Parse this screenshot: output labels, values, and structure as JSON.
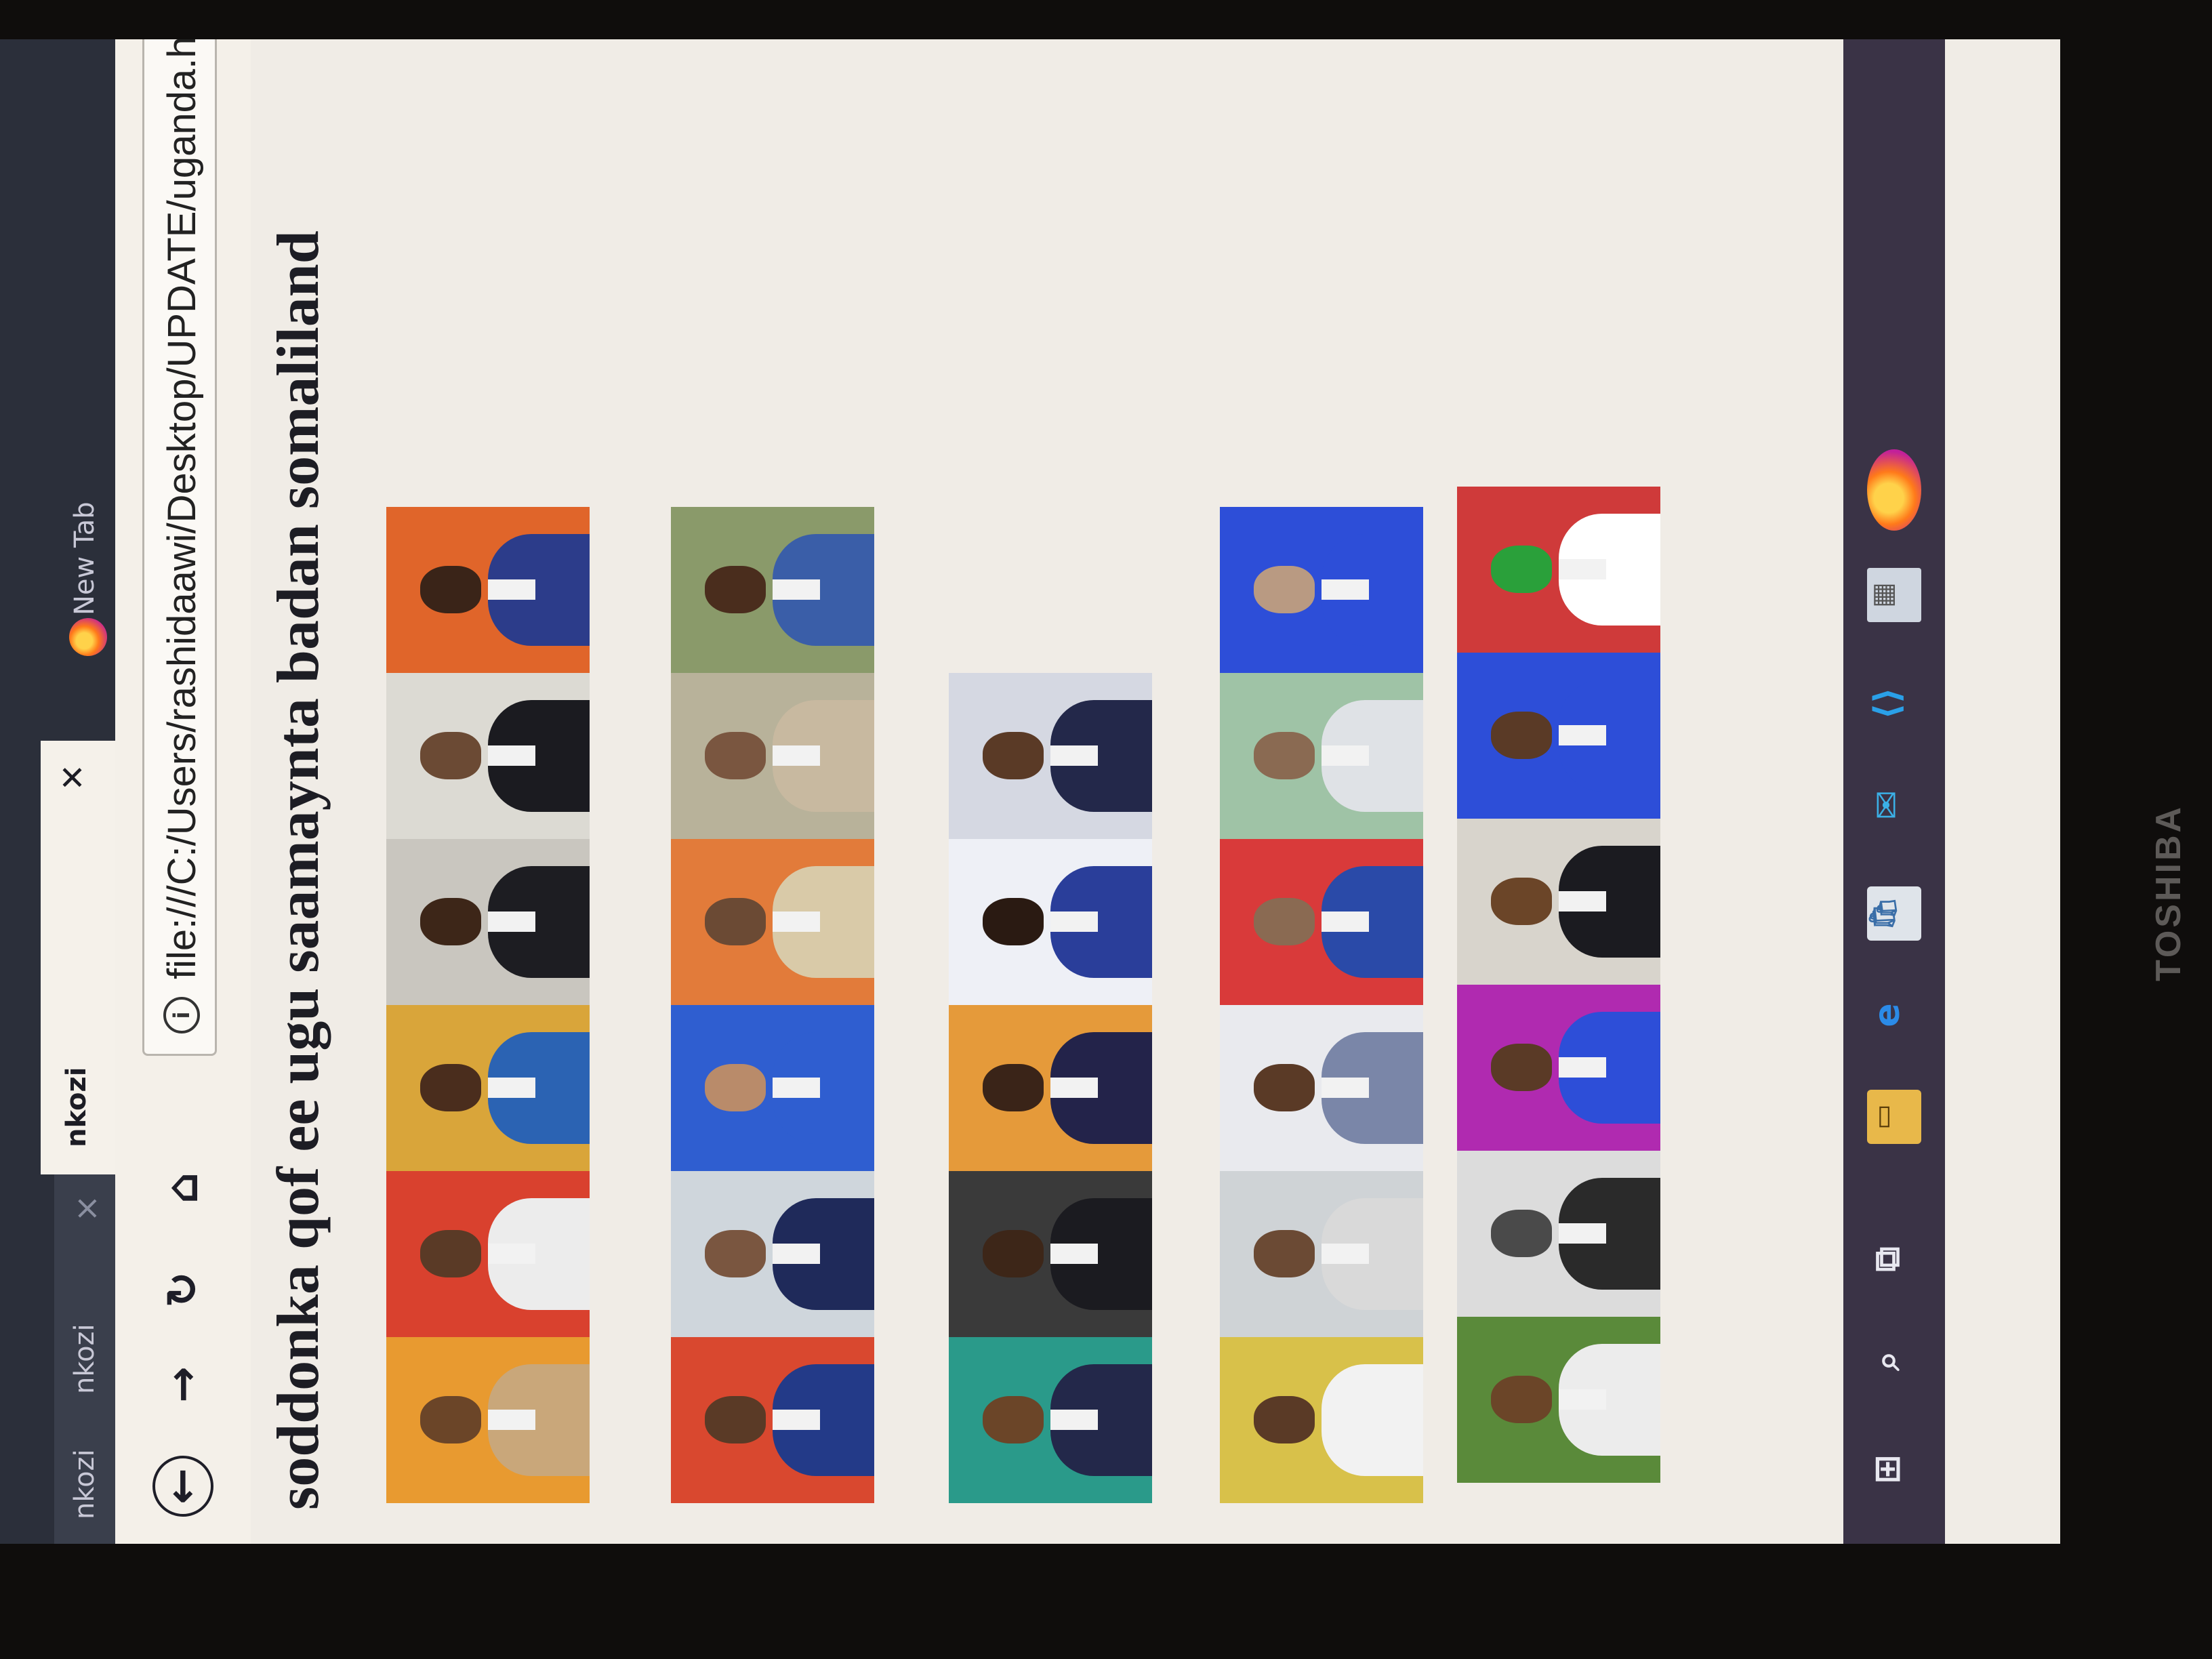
{
  "browser": {
    "tabs": [
      {
        "label": "nkozi",
        "active": false
      },
      {
        "label": "nkozi",
        "active": false
      },
      {
        "label": "nkozi",
        "active": true
      },
      {
        "label": "New Tab",
        "active": false
      }
    ],
    "url": "file:///C:/Users/rashidaawi/Desktop/UPDATE/uganda.html"
  },
  "page": {
    "heading": "soddonka qof ee ugu saamaynta badan somaliland"
  },
  "gallery": {
    "rows": [
      {
        "photos": [
          {
            "bg": "#e89a30",
            "skin": "#6b4528",
            "clothes": "#c9a77a"
          },
          {
            "bg": "#d9412e",
            "skin": "#5a3a26",
            "clothes": "#ececec"
          },
          {
            "bg": "#d9a53a",
            "skin": "#4a2d1d",
            "clothes": "#2b63b3"
          },
          {
            "bg": "#c9c6bf",
            "skin": "#3d2618",
            "clothes": "#1d1d22"
          },
          {
            "bg": "#dcdad3",
            "skin": "#6b4a34",
            "clothes": "#1b1b20"
          },
          {
            "bg": "#e0652a",
            "skin": "#3a2418",
            "clothes": "#2c3c8a"
          }
        ]
      },
      {
        "photos": [
          {
            "bg": "#d9482f",
            "skin": "#5a3a26",
            "clothes": "#233a88"
          },
          {
            "bg": "#cfd6dc",
            "skin": "#7a5640",
            "clothes": "#1f2a5a"
          },
          {
            "bg": "#2f5ed0",
            "skin": "#b98b6a",
            "clothes": "#2f5ed0"
          },
          {
            "bg": "#e27b3a",
            "skin": "#6b4a34",
            "clothes": "#d9caa8"
          },
          {
            "bg": "#b8b29a",
            "skin": "#7a5640",
            "clothes": "#c8b9a0"
          },
          {
            "bg": "#8a9a6a",
            "skin": "#4a2d1d",
            "clothes": "#3a5ea8"
          }
        ]
      },
      {
        "photos": [
          {
            "bg": "#2a9a8a",
            "skin": "#6b4528",
            "clothes": "#23284a"
          },
          {
            "bg": "#3a3a3a",
            "skin": "#3d2618",
            "clothes": "#1b1b20"
          },
          {
            "bg": "#e59a3a",
            "skin": "#3a2418",
            "clothes": "#23234a"
          },
          {
            "bg": "#eef0f6",
            "skin": "#2a1a12",
            "clothes": "#2a3e9a"
          },
          {
            "bg": "#d5d8e2",
            "skin": "#5a3a26",
            "clothes": "#23284a"
          }
        ]
      },
      {
        "photos": [
          {
            "bg": "#d8c14a",
            "skin": "#5a3a26",
            "clothes": "#f2f2f2"
          },
          {
            "bg": "#cfd3d6",
            "skin": "#6b4a34",
            "clothes": "#d9d9d9"
          },
          {
            "bg": "#e9eaee",
            "skin": "#5a3a26",
            "clothes": "#7a86a8"
          },
          {
            "bg": "#d93a3a",
            "skin": "#8a6a52",
            "clothes": "#2a4aa8"
          },
          {
            "bg": "#9fc3a6",
            "skin": "#8a6a52",
            "clothes": "#dfe2e6"
          },
          {
            "bg": "#2d4ed8",
            "skin": "#b99a82",
            "clothes": "#2d4ed8"
          }
        ]
      },
      {
        "photos": [
          {
            "bg": "#5a8a3a",
            "skin": "#6b4528",
            "clothes": "#ececec"
          },
          {
            "bg": "#dcdcdc",
            "skin": "#4a4a4a",
            "clothes": "#2a2a2a"
          },
          {
            "bg": "#b02ab0",
            "skin": "#5a3a26",
            "clothes": "#2d4ed8"
          },
          {
            "bg": "#d8d4cc",
            "skin": "#6b4528",
            "clothes": "#1b1b20"
          },
          {
            "bg": "#2d4ed8",
            "skin": "#5a3a26",
            "clothes": "#2d4ed8"
          },
          {
            "bg": "#cf3a3a",
            "skin": "#2aa03a",
            "clothes": "#ffffff"
          }
        ]
      }
    ]
  },
  "taskbar": {
    "items": [
      {
        "name": "windows-start-icon",
        "glyph": "⊞"
      },
      {
        "name": "search-icon",
        "glyph": "⌕"
      },
      {
        "name": "task-view-icon",
        "glyph": "⧉"
      },
      {
        "name": "file-explorer-icon",
        "glyph": "▭"
      },
      {
        "name": "edge-icon",
        "glyph": "e"
      },
      {
        "name": "store-icon",
        "glyph": "🛍"
      },
      {
        "name": "mail-icon",
        "glyph": "✉"
      },
      {
        "name": "vscode-icon",
        "glyph": "⟨⟩"
      },
      {
        "name": "app-icon",
        "glyph": "▦"
      },
      {
        "name": "firefox-icon",
        "glyph": ""
      }
    ]
  },
  "device": {
    "brand": "TOSHIBA"
  }
}
